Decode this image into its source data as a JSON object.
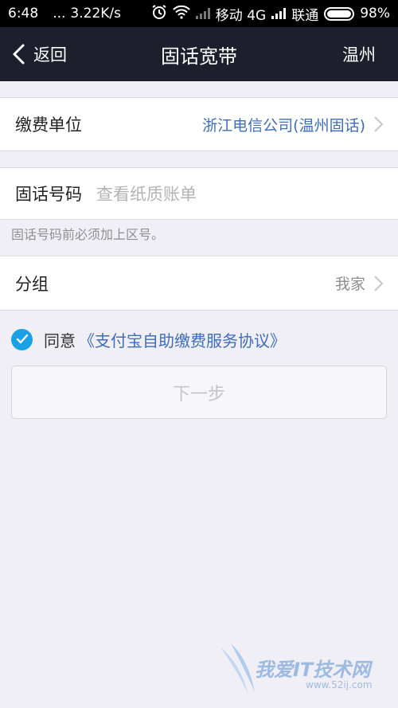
{
  "status_bar": {
    "time": "6:48",
    "dots": "...",
    "speed": "3.22K/s",
    "carrier1": "移动 4G",
    "carrier2": "联通",
    "battery": "98%",
    "battery_level": 0.98,
    "icons": [
      "alarm-icon",
      "wifi-icon",
      "signal-icon",
      "battery-icon"
    ]
  },
  "nav": {
    "back_label": "返回",
    "title": "固话宽带",
    "city": "温州",
    "background": "#1d1f2c"
  },
  "form": {
    "unit": {
      "label": "缴费单位",
      "value": "浙江电信公司(温州固话)",
      "value_color": "#3d6dbd"
    },
    "phone": {
      "label": "固话号码",
      "placeholder": "查看纸质账单"
    },
    "hint": "固话号码前必须加上区号。",
    "group": {
      "label": "分组",
      "value": "我家"
    }
  },
  "agreement": {
    "prefix": "同意",
    "link": "《支付宝自助缴费服务协议》",
    "checked": true,
    "check_color": "#1aa0e6"
  },
  "next_button": {
    "label": "下一步"
  },
  "watermark": {
    "text": "我爱IT技术网",
    "url": "www.52ij.com"
  }
}
